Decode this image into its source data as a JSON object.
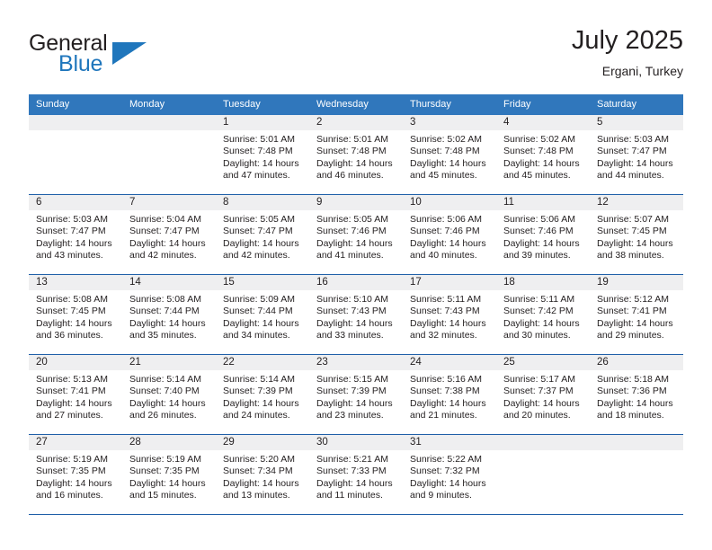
{
  "brand": {
    "name_part1": "General",
    "name_part2": "Blue",
    "triangle_icon": "triangle-icon",
    "color_primary": "#1f76bc",
    "color_text": "#231f20"
  },
  "header": {
    "title": "July 2025",
    "location": "Ergani, Turkey"
  },
  "calendar": {
    "header_bg": "#3077bc",
    "grid_line": "#1f5fa8",
    "daynum_bg": "#efeff0",
    "weekday_headers": [
      "Sunday",
      "Monday",
      "Tuesday",
      "Wednesday",
      "Thursday",
      "Friday",
      "Saturday"
    ],
    "weeks": [
      [
        {
          "day": "",
          "sunrise": "",
          "sunset": "",
          "daylight_line1": "",
          "daylight_line2": ""
        },
        {
          "day": "",
          "sunrise": "",
          "sunset": "",
          "daylight_line1": "",
          "daylight_line2": ""
        },
        {
          "day": "1",
          "sunrise": "Sunrise: 5:01 AM",
          "sunset": "Sunset: 7:48 PM",
          "daylight_line1": "Daylight: 14 hours",
          "daylight_line2": "and 47 minutes."
        },
        {
          "day": "2",
          "sunrise": "Sunrise: 5:01 AM",
          "sunset": "Sunset: 7:48 PM",
          "daylight_line1": "Daylight: 14 hours",
          "daylight_line2": "and 46 minutes."
        },
        {
          "day": "3",
          "sunrise": "Sunrise: 5:02 AM",
          "sunset": "Sunset: 7:48 PM",
          "daylight_line1": "Daylight: 14 hours",
          "daylight_line2": "and 45 minutes."
        },
        {
          "day": "4",
          "sunrise": "Sunrise: 5:02 AM",
          "sunset": "Sunset: 7:48 PM",
          "daylight_line1": "Daylight: 14 hours",
          "daylight_line2": "and 45 minutes."
        },
        {
          "day": "5",
          "sunrise": "Sunrise: 5:03 AM",
          "sunset": "Sunset: 7:47 PM",
          "daylight_line1": "Daylight: 14 hours",
          "daylight_line2": "and 44 minutes."
        }
      ],
      [
        {
          "day": "6",
          "sunrise": "Sunrise: 5:03 AM",
          "sunset": "Sunset: 7:47 PM",
          "daylight_line1": "Daylight: 14 hours",
          "daylight_line2": "and 43 minutes."
        },
        {
          "day": "7",
          "sunrise": "Sunrise: 5:04 AM",
          "sunset": "Sunset: 7:47 PM",
          "daylight_line1": "Daylight: 14 hours",
          "daylight_line2": "and 42 minutes."
        },
        {
          "day": "8",
          "sunrise": "Sunrise: 5:05 AM",
          "sunset": "Sunset: 7:47 PM",
          "daylight_line1": "Daylight: 14 hours",
          "daylight_line2": "and 42 minutes."
        },
        {
          "day": "9",
          "sunrise": "Sunrise: 5:05 AM",
          "sunset": "Sunset: 7:46 PM",
          "daylight_line1": "Daylight: 14 hours",
          "daylight_line2": "and 41 minutes."
        },
        {
          "day": "10",
          "sunrise": "Sunrise: 5:06 AM",
          "sunset": "Sunset: 7:46 PM",
          "daylight_line1": "Daylight: 14 hours",
          "daylight_line2": "and 40 minutes."
        },
        {
          "day": "11",
          "sunrise": "Sunrise: 5:06 AM",
          "sunset": "Sunset: 7:46 PM",
          "daylight_line1": "Daylight: 14 hours",
          "daylight_line2": "and 39 minutes."
        },
        {
          "day": "12",
          "sunrise": "Sunrise: 5:07 AM",
          "sunset": "Sunset: 7:45 PM",
          "daylight_line1": "Daylight: 14 hours",
          "daylight_line2": "and 38 minutes."
        }
      ],
      [
        {
          "day": "13",
          "sunrise": "Sunrise: 5:08 AM",
          "sunset": "Sunset: 7:45 PM",
          "daylight_line1": "Daylight: 14 hours",
          "daylight_line2": "and 36 minutes."
        },
        {
          "day": "14",
          "sunrise": "Sunrise: 5:08 AM",
          "sunset": "Sunset: 7:44 PM",
          "daylight_line1": "Daylight: 14 hours",
          "daylight_line2": "and 35 minutes."
        },
        {
          "day": "15",
          "sunrise": "Sunrise: 5:09 AM",
          "sunset": "Sunset: 7:44 PM",
          "daylight_line1": "Daylight: 14 hours",
          "daylight_line2": "and 34 minutes."
        },
        {
          "day": "16",
          "sunrise": "Sunrise: 5:10 AM",
          "sunset": "Sunset: 7:43 PM",
          "daylight_line1": "Daylight: 14 hours",
          "daylight_line2": "and 33 minutes."
        },
        {
          "day": "17",
          "sunrise": "Sunrise: 5:11 AM",
          "sunset": "Sunset: 7:43 PM",
          "daylight_line1": "Daylight: 14 hours",
          "daylight_line2": "and 32 minutes."
        },
        {
          "day": "18",
          "sunrise": "Sunrise: 5:11 AM",
          "sunset": "Sunset: 7:42 PM",
          "daylight_line1": "Daylight: 14 hours",
          "daylight_line2": "and 30 minutes."
        },
        {
          "day": "19",
          "sunrise": "Sunrise: 5:12 AM",
          "sunset": "Sunset: 7:41 PM",
          "daylight_line1": "Daylight: 14 hours",
          "daylight_line2": "and 29 minutes."
        }
      ],
      [
        {
          "day": "20",
          "sunrise": "Sunrise: 5:13 AM",
          "sunset": "Sunset: 7:41 PM",
          "daylight_line1": "Daylight: 14 hours",
          "daylight_line2": "and 27 minutes."
        },
        {
          "day": "21",
          "sunrise": "Sunrise: 5:14 AM",
          "sunset": "Sunset: 7:40 PM",
          "daylight_line1": "Daylight: 14 hours",
          "daylight_line2": "and 26 minutes."
        },
        {
          "day": "22",
          "sunrise": "Sunrise: 5:14 AM",
          "sunset": "Sunset: 7:39 PM",
          "daylight_line1": "Daylight: 14 hours",
          "daylight_line2": "and 24 minutes."
        },
        {
          "day": "23",
          "sunrise": "Sunrise: 5:15 AM",
          "sunset": "Sunset: 7:39 PM",
          "daylight_line1": "Daylight: 14 hours",
          "daylight_line2": "and 23 minutes."
        },
        {
          "day": "24",
          "sunrise": "Sunrise: 5:16 AM",
          "sunset": "Sunset: 7:38 PM",
          "daylight_line1": "Daylight: 14 hours",
          "daylight_line2": "and 21 minutes."
        },
        {
          "day": "25",
          "sunrise": "Sunrise: 5:17 AM",
          "sunset": "Sunset: 7:37 PM",
          "daylight_line1": "Daylight: 14 hours",
          "daylight_line2": "and 20 minutes."
        },
        {
          "day": "26",
          "sunrise": "Sunrise: 5:18 AM",
          "sunset": "Sunset: 7:36 PM",
          "daylight_line1": "Daylight: 14 hours",
          "daylight_line2": "and 18 minutes."
        }
      ],
      [
        {
          "day": "27",
          "sunrise": "Sunrise: 5:19 AM",
          "sunset": "Sunset: 7:35 PM",
          "daylight_line1": "Daylight: 14 hours",
          "daylight_line2": "and 16 minutes."
        },
        {
          "day": "28",
          "sunrise": "Sunrise: 5:19 AM",
          "sunset": "Sunset: 7:35 PM",
          "daylight_line1": "Daylight: 14 hours",
          "daylight_line2": "and 15 minutes."
        },
        {
          "day": "29",
          "sunrise": "Sunrise: 5:20 AM",
          "sunset": "Sunset: 7:34 PM",
          "daylight_line1": "Daylight: 14 hours",
          "daylight_line2": "and 13 minutes."
        },
        {
          "day": "30",
          "sunrise": "Sunrise: 5:21 AM",
          "sunset": "Sunset: 7:33 PM",
          "daylight_line1": "Daylight: 14 hours",
          "daylight_line2": "and 11 minutes."
        },
        {
          "day": "31",
          "sunrise": "Sunrise: 5:22 AM",
          "sunset": "Sunset: 7:32 PM",
          "daylight_line1": "Daylight: 14 hours",
          "daylight_line2": "and 9 minutes."
        },
        {
          "day": "",
          "sunrise": "",
          "sunset": "",
          "daylight_line1": "",
          "daylight_line2": ""
        },
        {
          "day": "",
          "sunrise": "",
          "sunset": "",
          "daylight_line1": "",
          "daylight_line2": ""
        }
      ]
    ]
  }
}
